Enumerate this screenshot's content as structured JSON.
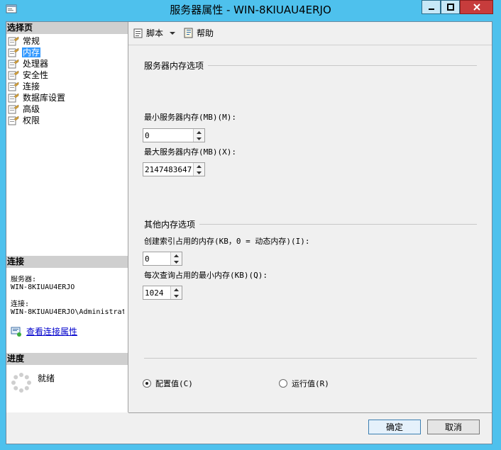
{
  "window": {
    "title": "服务器属性 - WIN-8KIUAU4ERJO"
  },
  "left": {
    "select_page_header": "选择页",
    "pages": [
      "常规",
      "内存",
      "处理器",
      "安全性",
      "连接",
      "数据库设置",
      "高级",
      "权限"
    ],
    "selected_index": 1,
    "connection_header": "连接",
    "server_label": "服务器:",
    "server_value": "WIN-8KIUAU4ERJO",
    "connection_label": "连接:",
    "connection_value": "WIN-8KIUAU4ERJO\\Administrat",
    "view_connection_link": "查看连接属性",
    "progress_header": "进度",
    "progress_status": "就绪"
  },
  "toolbar": {
    "script_label": "脚本",
    "help_label": "帮助"
  },
  "memory": {
    "group_title": "服务器内存选项",
    "min_label": "最小服务器内存(MB)(M):",
    "min_value": "0",
    "max_label": "最大服务器内存(MB)(X):",
    "max_value": "2147483647",
    "other_title": "其他内存选项",
    "index_label": "创建索引占用的内存(KB，0 = 动态内存)(I):",
    "index_value": "0",
    "query_label": "每次查询占用的最小内存(KB)(Q):",
    "query_value": "1024"
  },
  "options": {
    "config_label": "配置值(C)",
    "running_label": "运行值(R)",
    "selected": "config"
  },
  "footer": {
    "ok_label": "确定",
    "cancel_label": "取消"
  }
}
